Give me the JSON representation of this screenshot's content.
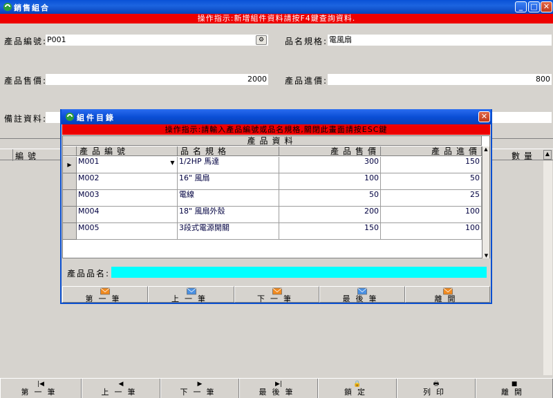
{
  "window": {
    "title": "銷售組合"
  },
  "hint": "操作指示:新增組件資料請按F4鍵查詢資料.",
  "form": {
    "product_code_label": "產品編號:",
    "product_code_value": "P001",
    "spec_label": "品名規格:",
    "spec_value": "電風扇",
    "sale_price_label": "產品售價:",
    "sale_price_value": "2000",
    "cost_price_label": "產品進價:",
    "cost_price_value": "800",
    "note_label": "備註資料:"
  },
  "bg_grid": {
    "col_code": "編號",
    "col_qty": "數量"
  },
  "toolbar": [
    {
      "icon": "first-record-icon",
      "glyph": "|◀",
      "label": "第一筆"
    },
    {
      "icon": "prev-record-icon",
      "glyph": "◀",
      "label": "上一筆"
    },
    {
      "icon": "next-record-icon",
      "glyph": "▶",
      "label": "下一筆"
    },
    {
      "icon": "last-record-icon",
      "glyph": "▶|",
      "label": "最後筆"
    },
    {
      "icon": "lock-icon",
      "glyph": "🔒",
      "label": "鎖定"
    },
    {
      "icon": "printer-icon",
      "glyph": "🖶",
      "label": "列印"
    },
    {
      "icon": "disk-icon",
      "glyph": "■",
      "label": "離開"
    }
  ],
  "dialog": {
    "title": "組件目錄",
    "hint": "操作指示:請輸入產品編號或品名規格,關閉此畫面請按ESC鍵",
    "group_header": "產品資料",
    "columns": [
      "產品編號",
      "品名規格",
      "產品售價",
      "產品進價"
    ],
    "rows": [
      {
        "code": "M001",
        "name": "1/2HP 馬達",
        "price": "300",
        "cost": "150"
      },
      {
        "code": "M002",
        "name": "16\" 風扇",
        "price": "100",
        "cost": "50"
      },
      {
        "code": "M003",
        "name": "電線",
        "price": "50",
        "cost": "25"
      },
      {
        "code": "M004",
        "name": "18\" 風扇外殼",
        "price": "200",
        "cost": "100"
      },
      {
        "code": "M005",
        "name": "3段式電源開關",
        "price": "150",
        "cost": "100"
      }
    ],
    "search_label": "產品品名:",
    "search_value": "",
    "buttons": [
      {
        "icon": "envelope-orange-icon",
        "label": "第一筆",
        "color": "#f08a20"
      },
      {
        "icon": "envelope-blue-icon",
        "label": "上一筆",
        "color": "#4a90e2"
      },
      {
        "icon": "envelope-orange-icon",
        "label": "下一筆",
        "color": "#f08a20"
      },
      {
        "icon": "envelope-blue-icon",
        "label": "最後筆",
        "color": "#4a90e2"
      },
      {
        "icon": "envelope-orange-icon",
        "label": "離開",
        "color": "#f08a20"
      }
    ]
  }
}
